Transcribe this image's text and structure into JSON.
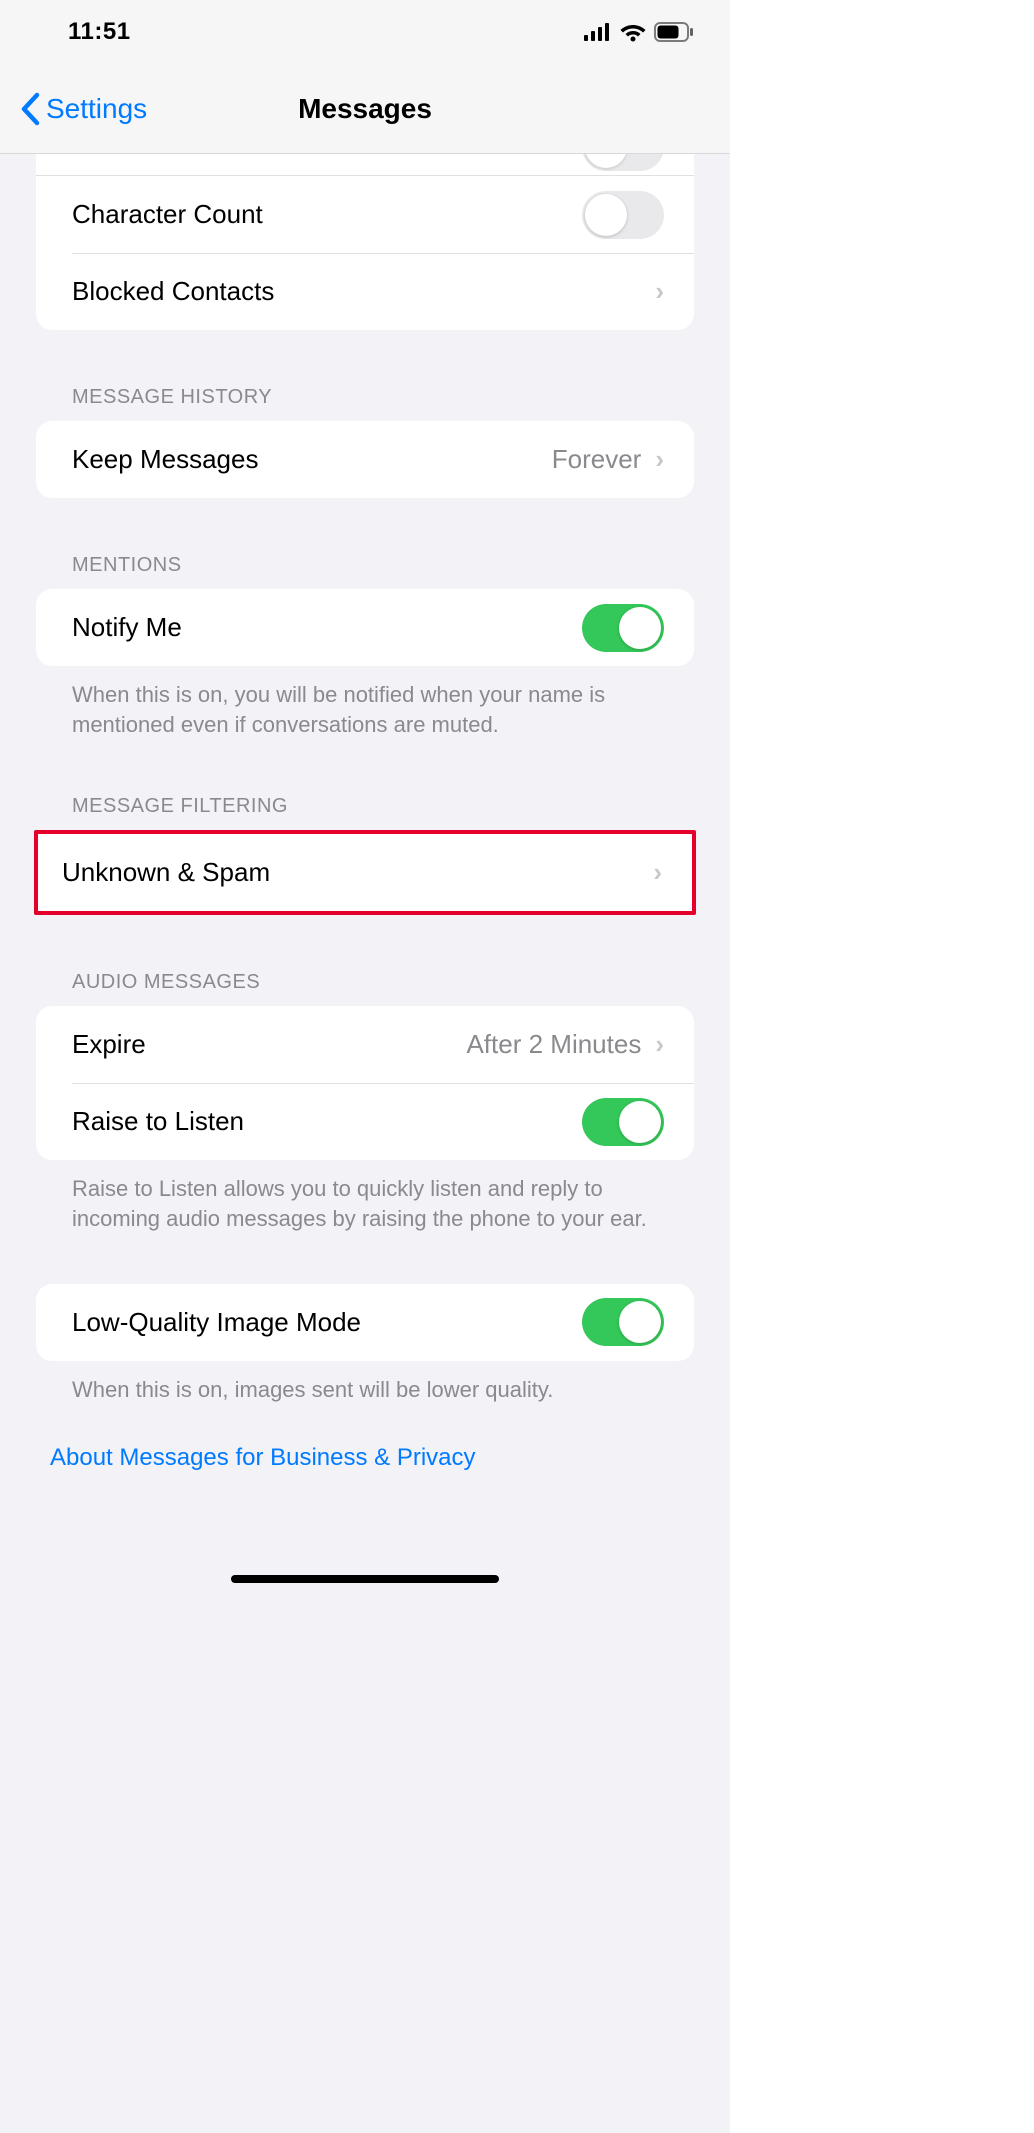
{
  "status": {
    "time": "11:51"
  },
  "nav": {
    "back_label": "Settings",
    "title": "Messages"
  },
  "sections": {
    "top": {
      "character_count": {
        "label": "Character Count",
        "on": false
      },
      "blocked_contacts": {
        "label": "Blocked Contacts"
      }
    },
    "message_history": {
      "header": "MESSAGE HISTORY",
      "keep_messages": {
        "label": "Keep Messages",
        "value": "Forever"
      }
    },
    "mentions": {
      "header": "MENTIONS",
      "notify_me": {
        "label": "Notify Me",
        "on": true
      },
      "footer": "When this is on, you will be notified when your name is mentioned even if conversations are muted."
    },
    "message_filtering": {
      "header": "MESSAGE FILTERING",
      "unknown_spam": {
        "label": "Unknown & Spam"
      }
    },
    "audio_messages": {
      "header": "AUDIO MESSAGES",
      "expire": {
        "label": "Expire",
        "value": "After 2 Minutes"
      },
      "raise_to_listen": {
        "label": "Raise to Listen",
        "on": true
      },
      "footer": "Raise to Listen allows you to quickly listen and reply to incoming audio messages by raising the phone to your ear."
    },
    "low_quality": {
      "row": {
        "label": "Low-Quality Image Mode",
        "on": true
      },
      "footer": "When this is on, images sent will be lower quality."
    }
  },
  "about_link": "About Messages for Business & Privacy"
}
